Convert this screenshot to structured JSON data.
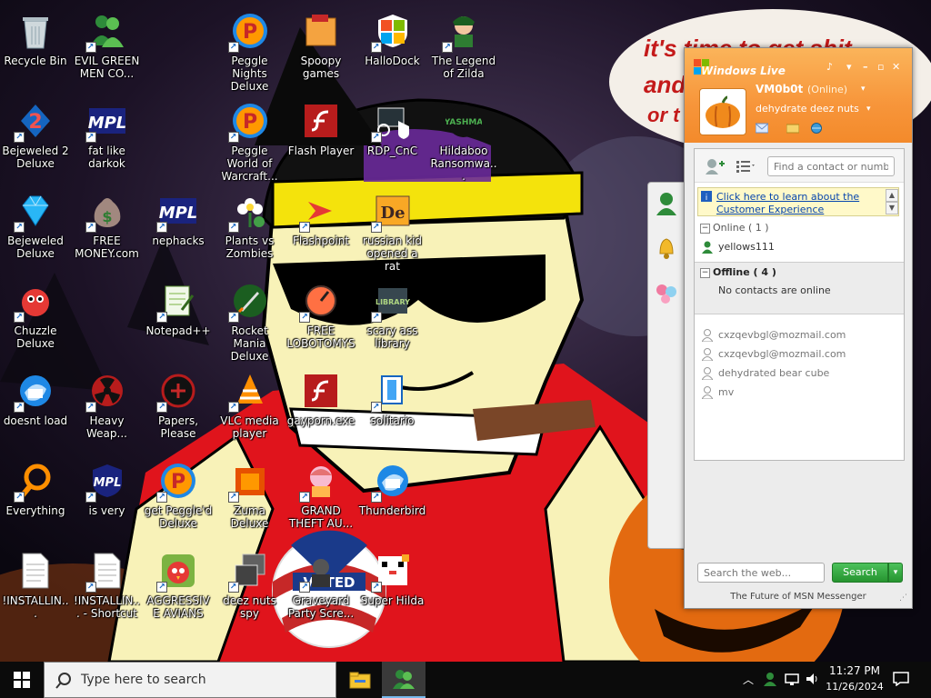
{
  "wallpaper": {
    "caption_lines": [
      "it's time to get shit",
      "and",
      "or t"
    ],
    "badge_text": "VOTED"
  },
  "desktop_icons": [
    {
      "label": "Recycle Bin",
      "icon": "recycle-bin-icon",
      "shortcut": false
    },
    {
      "label": "EVIL GREEN MEN CO...",
      "icon": "green-men-icon",
      "shortcut": true
    },
    {
      "label": "Peggle Nights Deluxe",
      "icon": "peggle-icon",
      "shortcut": true
    },
    {
      "label": "Spoopy games",
      "icon": "folder-icon",
      "shortcut": false
    },
    {
      "label": "HalloDock",
      "icon": "windows-shield-icon",
      "shortcut": true
    },
    {
      "label": "The Legend of Zilda",
      "icon": "game-character-icon",
      "shortcut": true
    },
    {
      "label": "Bejeweled 2 Deluxe",
      "icon": "bejeweled-2-icon",
      "shortcut": true
    },
    {
      "label": "fat like darkok",
      "icon": "mpl-icon",
      "shortcut": true
    },
    {
      "label": "Peggle World of Warcraft...",
      "icon": "peggle-icon",
      "shortcut": true
    },
    {
      "label": "Flash Player",
      "icon": "flash-icon",
      "shortcut": false
    },
    {
      "label": "RDP_CnC",
      "icon": "rdp-icon",
      "shortcut": true
    },
    {
      "label": "Hildaboo Ransomwa...",
      "icon": "yashma-icon",
      "shortcut": false
    },
    {
      "label": "Bejeweled Deluxe",
      "icon": "diamond-icon",
      "shortcut": true
    },
    {
      "label": "FREE MONEY.com",
      "icon": "money-bag-icon",
      "shortcut": true
    },
    {
      "label": "nephacks",
      "icon": "mpl-icon",
      "shortcut": true
    },
    {
      "label": "Plants vs Zombies",
      "icon": "flower-icon",
      "shortcut": true
    },
    {
      "label": "Flashpoint",
      "icon": "flashpoint-icon",
      "shortcut": true
    },
    {
      "label": "russian kid opened a rat",
      "icon": "de-icon",
      "shortcut": true
    },
    {
      "label": "Chuzzle Deluxe",
      "icon": "chuzzle-icon",
      "shortcut": true
    },
    {
      "label": "Notepad++",
      "icon": "notepad-icon",
      "shortcut": true
    },
    {
      "label": "Rocket Mania Deluxe",
      "icon": "rocket-icon",
      "shortcut": true
    },
    {
      "label": "FREE LOBOTOMYS",
      "icon": "dial-icon",
      "shortcut": true
    },
    {
      "label": "scary ass library",
      "icon": "library-icon",
      "shortcut": true
    },
    {
      "label": "doesnt load",
      "icon": "thunderbird-icon",
      "shortcut": true
    },
    {
      "label": "Heavy Weap...",
      "icon": "radiation-icon",
      "shortcut": true
    },
    {
      "label": "Papers, Please",
      "icon": "papers-please-icon",
      "shortcut": true
    },
    {
      "label": "VLC media player",
      "icon": "vlc-icon",
      "shortcut": true
    },
    {
      "label": "gayporn.exe",
      "icon": "flash-icon",
      "shortcut": false
    },
    {
      "label": "solitario",
      "icon": "solitaire-icon",
      "shortcut": true
    },
    {
      "label": "Everything",
      "icon": "search-ring-icon",
      "shortcut": true
    },
    {
      "label": "is very",
      "icon": "mpl-shield-icon",
      "shortcut": true
    },
    {
      "label": "get Peggle'd Deluxe",
      "icon": "peggle-icon",
      "shortcut": true
    },
    {
      "label": "Zuma Deluxe",
      "icon": "zuma-icon",
      "shortcut": true
    },
    {
      "label": "GRAND THEFT AU...",
      "icon": "anime-girl-icon",
      "shortcut": true
    },
    {
      "label": "Thunderbird",
      "icon": "thunderbird-icon",
      "shortcut": true
    },
    {
      "label": "!INSTALLIN...",
      "icon": "document-icon",
      "shortcut": false
    },
    {
      "label": "!INSTALLIN... - Shortcut",
      "icon": "document-icon",
      "shortcut": true
    },
    {
      "label": "AGGRESSIVE AVIANS",
      "icon": "angry-bird-icon",
      "shortcut": true
    },
    {
      "label": "deez nuts spy",
      "icon": "stacked-windows-icon",
      "shortcut": true
    },
    {
      "label": "Graveyard Party Scre...",
      "icon": "graveyard-icon",
      "shortcut": true
    },
    {
      "label": "Super Hilda",
      "icon": "pixel-dog-icon",
      "shortcut": true
    }
  ],
  "msn": {
    "title": "Windows Live",
    "username": "VM0b0t",
    "status": "(Online)",
    "personal_message": "dehydrate deez nuts",
    "find_placeholder": "Find a contact or numbe",
    "promo_text": "Click here to learn about the Customer Experience",
    "online_header": "Online ( 1 )",
    "online_contacts": [
      "yellows111"
    ],
    "offline_header": "Offline ( 4 )",
    "offline_note": "No contacts are online",
    "other_contacts": [
      "cxzqevbgl@mozmail.com",
      "cxzqevbgl@mozmail.com",
      "dehydrated bear cube",
      "mv"
    ],
    "web_search_placeholder": "Search the web...",
    "search_button": "Search",
    "footer": "The Future of MSN Messenger",
    "accent": "#f7953a",
    "search_green": "#26942f"
  },
  "taskbar": {
    "search_placeholder": "Type here to search",
    "time": "11:27 PM",
    "date": "11/26/2024"
  }
}
